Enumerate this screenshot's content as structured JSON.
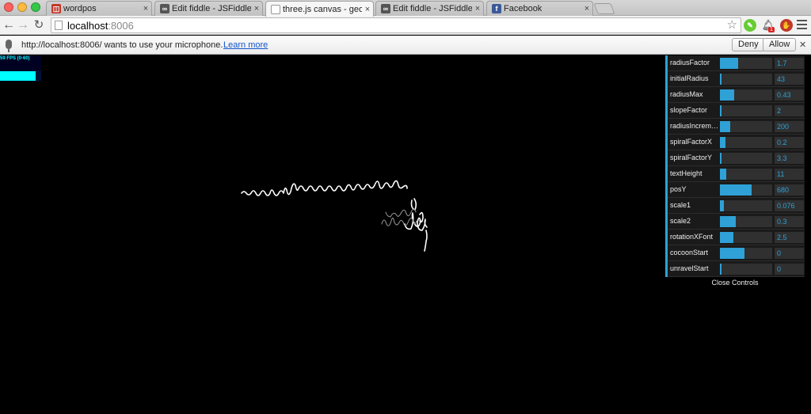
{
  "colors": {
    "accent": "#2fa1d6",
    "fps": "#00ffff",
    "link": "#1155cc"
  },
  "tabs": [
    {
      "title": "wordpos",
      "icon": "wordpos-favicon-icon",
      "active": false
    },
    {
      "title": "Edit fiddle - JSFiddle",
      "icon": "jsfiddle-favicon-icon",
      "active": false
    },
    {
      "title": "three.js canvas - geometry",
      "icon": "page-icon",
      "active": true
    },
    {
      "title": "Edit fiddle - JSFiddle",
      "icon": "jsfiddle-favicon-icon",
      "active": false
    },
    {
      "title": "Facebook",
      "icon": "facebook-favicon-icon",
      "active": false
    }
  ],
  "toolbar": {
    "url_host": "localhost",
    "url_port": ":8006"
  },
  "infobar": {
    "message": "http://localhost:8006/ wants to use your microphone.",
    "learn_more": "Learn more",
    "deny": "Deny",
    "allow": "Allow",
    "badge_count": "1"
  },
  "stats": {
    "fps_text": "59 FPS (0-60)",
    "fps": 59
  },
  "controls": [
    {
      "label": "radiusFactor",
      "value": "1.7",
      "fill": 0.35
    },
    {
      "label": "initialRadius",
      "value": "43",
      "fill": 0.03
    },
    {
      "label": "radiusMax",
      "value": "0.43",
      "fill": 0.28
    },
    {
      "label": "slopeFactor",
      "value": "2",
      "fill": 0.0
    },
    {
      "label": "radiusIncrement",
      "value": "200",
      "fill": 0.2
    },
    {
      "label": "spiralFactorX",
      "value": "0.2",
      "fill": 0.1
    },
    {
      "label": "spiralFactorY",
      "value": "3.3",
      "fill": 0.03
    },
    {
      "label": "textHeight",
      "value": "11",
      "fill": 0.12
    },
    {
      "label": "posY",
      "value": "680",
      "fill": 0.6
    },
    {
      "label": "scale1",
      "value": "0.076",
      "fill": 0.08
    },
    {
      "label": "scale2",
      "value": "0.3",
      "fill": 0.3
    },
    {
      "label": "rotationXFont",
      "value": "2.5",
      "fill": 0.25
    },
    {
      "label": "cocoonStart",
      "value": "0",
      "fill": 0.47
    },
    {
      "label": "unravelStart",
      "value": "0",
      "fill": 0.0
    }
  ],
  "close_controls": "Close Controls"
}
